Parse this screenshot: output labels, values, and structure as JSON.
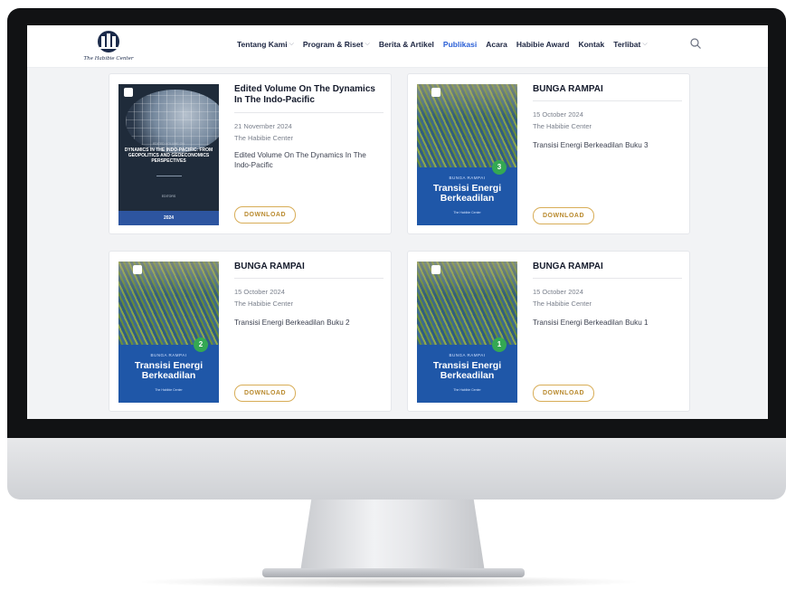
{
  "site": {
    "logo_text": "The Habibie Center"
  },
  "nav": [
    {
      "label": "Tentang Kami",
      "dropdown": true,
      "active": false
    },
    {
      "label": "Program & Riset",
      "dropdown": true,
      "active": false
    },
    {
      "label": "Berita & Artikel",
      "dropdown": false,
      "active": false
    },
    {
      "label": "Publikasi",
      "dropdown": false,
      "active": true
    },
    {
      "label": "Acara",
      "dropdown": false,
      "active": false
    },
    {
      "label": "Habibie Award",
      "dropdown": false,
      "active": false
    },
    {
      "label": "Kontak",
      "dropdown": false,
      "active": false
    },
    {
      "label": "Terlibat",
      "dropdown": true,
      "active": false
    }
  ],
  "cards": [
    {
      "title": "Edited Volume On The Dynamics In The Indo-Pacific",
      "date": "21 November 2024",
      "author": "The Habibie Center",
      "description": "Edited Volume On The Dynamics In The Indo-Pacific",
      "download": "DOWNLOAD",
      "cover": {
        "small": "EDITED VOLUME ON",
        "title": "DYNAMICS IN THE INDO-PACIFIC: FROM GEOPOLITICS AND GEOECONOMICS PERSPECTIVES",
        "editors": "EDITORS",
        "year": "2024"
      }
    },
    {
      "title": "BUNGA RAMPAI",
      "date": "15 October 2024",
      "author": "The Habibie Center",
      "description": "Transisi Energi Berkeadilan Buku 3",
      "download": "DOWNLOAD",
      "cover": {
        "badge": "3",
        "small": "BUNGA RAMPAI",
        "title": "Transisi Energi Berkeadilan",
        "foot": "The Habibie Center"
      }
    },
    {
      "title": "BUNGA RAMPAI",
      "date": "15 October 2024",
      "author": "The Habibie Center",
      "description": "Transisi Energi Berkeadilan Buku 2",
      "download": "DOWNLOAD",
      "cover": {
        "badge": "2",
        "small": "BUNGA RAMPAI",
        "title": "Transisi Energi Berkeadilan",
        "foot": "The Habibie Center"
      }
    },
    {
      "title": "BUNGA RAMPAI",
      "date": "15 October 2024",
      "author": "The Habibie Center",
      "description": "Transisi Energi Berkeadilan Buku 1",
      "download": "DOWNLOAD",
      "cover": {
        "badge": "1",
        "small": "BUNGA RAMPAI",
        "title": "Transisi Energi Berkeadilan",
        "foot": "The Habibie Center"
      }
    }
  ],
  "colors": {
    "accent": "#2a5fd6",
    "download": "#d8ad57",
    "cover_blue": "#1f57a8",
    "badge_green": "#34a853"
  }
}
